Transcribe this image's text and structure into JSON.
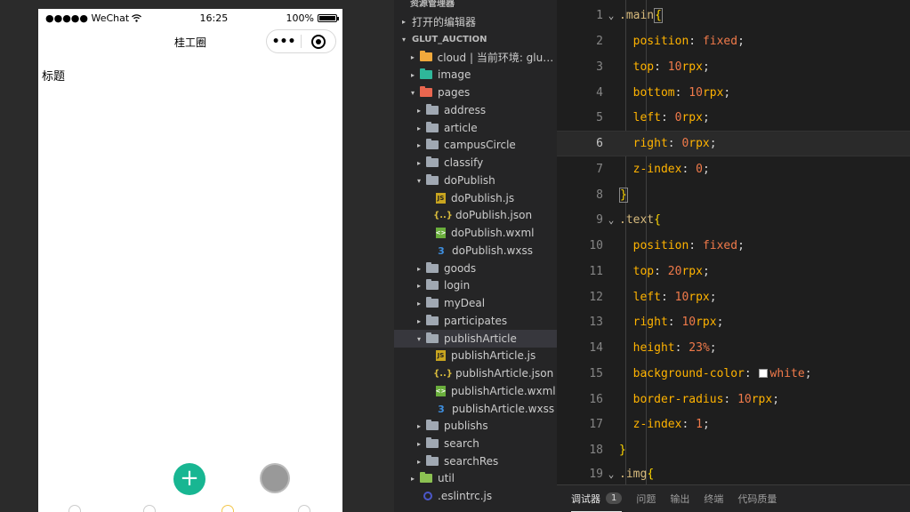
{
  "simulator": {
    "status": {
      "carrier": "●●●●● WeChat",
      "wifi_icon": "wifi-icon",
      "time": "16:25",
      "battery_pct": "100%"
    },
    "nav_title": "桂工圈",
    "capsule": {
      "menu_label": "•••"
    },
    "content_title": "标题",
    "fab_add_label": "+"
  },
  "explorer": {
    "section_top": "资源管理器",
    "open_editors": "打开的编辑器",
    "project": "GLUT_AUCTION",
    "items": [
      {
        "label": "cloud | 当前环境: glut-..."
      },
      {
        "label": "image"
      },
      {
        "label": "pages"
      },
      {
        "label": "address"
      },
      {
        "label": "article"
      },
      {
        "label": "campusCircle"
      },
      {
        "label": "classify"
      },
      {
        "label": "doPublish"
      },
      {
        "label": "doPublish.js"
      },
      {
        "label": "doPublish.json"
      },
      {
        "label": "doPublish.wxml"
      },
      {
        "label": "doPublish.wxss"
      },
      {
        "label": "goods"
      },
      {
        "label": "login"
      },
      {
        "label": "myDeal"
      },
      {
        "label": "participates"
      },
      {
        "label": "publishArticle"
      },
      {
        "label": "publishArticle.js"
      },
      {
        "label": "publishArticle.json"
      },
      {
        "label": "publishArticle.wxml"
      },
      {
        "label": "publishArticle.wxss"
      },
      {
        "label": "publishs"
      },
      {
        "label": "search"
      },
      {
        "label": "searchRes"
      },
      {
        "label": "util"
      },
      {
        "label": ".eslintrc.js"
      }
    ]
  },
  "editor": {
    "lines": [
      {
        "num": "1",
        "selector": ".main",
        "brace": "{"
      },
      {
        "num": "2",
        "prop": "position",
        "value": "fixed"
      },
      {
        "num": "3",
        "prop": "top",
        "num_val": "10",
        "unit": "rpx"
      },
      {
        "num": "4",
        "prop": "bottom",
        "num_val": "10",
        "unit": "rpx"
      },
      {
        "num": "5",
        "prop": "left",
        "num_val": "0",
        "unit": "rpx"
      },
      {
        "num": "6",
        "prop": "right",
        "num_val": "0",
        "unit": "rpx"
      },
      {
        "num": "7",
        "prop": "z-index",
        "num_val": "0",
        "unit": ""
      },
      {
        "num": "8",
        "close": "}"
      },
      {
        "num": "9",
        "selector": ".text",
        "brace": "{"
      },
      {
        "num": "10",
        "prop": "position",
        "value": "fixed"
      },
      {
        "num": "11",
        "prop": "top",
        "num_val": "20",
        "unit": "rpx"
      },
      {
        "num": "12",
        "prop": "left",
        "num_val": "10",
        "unit": "rpx"
      },
      {
        "num": "13",
        "prop": "right",
        "num_val": "10",
        "unit": "rpx"
      },
      {
        "num": "14",
        "prop": "height",
        "num_val": "23",
        "unit": "%"
      },
      {
        "num": "15",
        "prop": "background-color",
        "value": "white",
        "swatch": true
      },
      {
        "num": "16",
        "prop": "border-radius",
        "num_val": "10",
        "unit": "rpx"
      },
      {
        "num": "17",
        "prop": "z-index",
        "num_val": "1",
        "unit": ""
      },
      {
        "num": "18",
        "close": "}"
      },
      {
        "num": "19",
        "selector": ".img",
        "brace": "{"
      }
    ]
  },
  "panel": {
    "tabs": [
      {
        "label": "调试器",
        "badge": "1"
      },
      {
        "label": "问题"
      },
      {
        "label": "输出"
      },
      {
        "label": "终端"
      },
      {
        "label": "代码质量"
      }
    ]
  },
  "colors": {
    "accent_green": "#18b692",
    "editor_bg": "#1e1e1e",
    "sidebar_bg": "#252526"
  }
}
